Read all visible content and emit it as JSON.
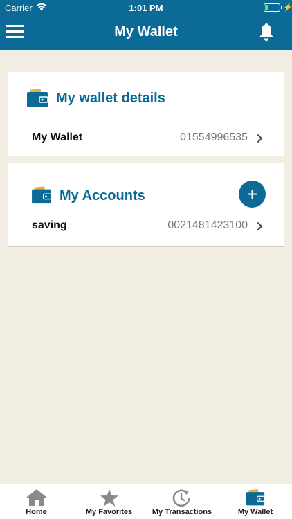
{
  "status_bar": {
    "carrier": "Carrier",
    "time": "1:01 PM",
    "battery_level": 0.25
  },
  "nav": {
    "title": "My Wallet"
  },
  "wallet_details": {
    "title": "My wallet details",
    "row": {
      "label": "My Wallet",
      "value": "01554996535"
    }
  },
  "accounts": {
    "title": "My Accounts",
    "rows": [
      {
        "label": "saving",
        "value": "0021481423100"
      }
    ]
  },
  "tabs": [
    {
      "label": "Home",
      "icon": "home-icon"
    },
    {
      "label": "My Favorites",
      "icon": "star-icon"
    },
    {
      "label": "My Transactions",
      "icon": "clock-icon"
    },
    {
      "label": "My Wallet",
      "icon": "wallet-icon"
    }
  ],
  "colors": {
    "primary": "#0b6a96",
    "background": "#f1ede2",
    "tab_inactive": "#8a8a8a",
    "wallet_gold": "#e2b43a"
  }
}
